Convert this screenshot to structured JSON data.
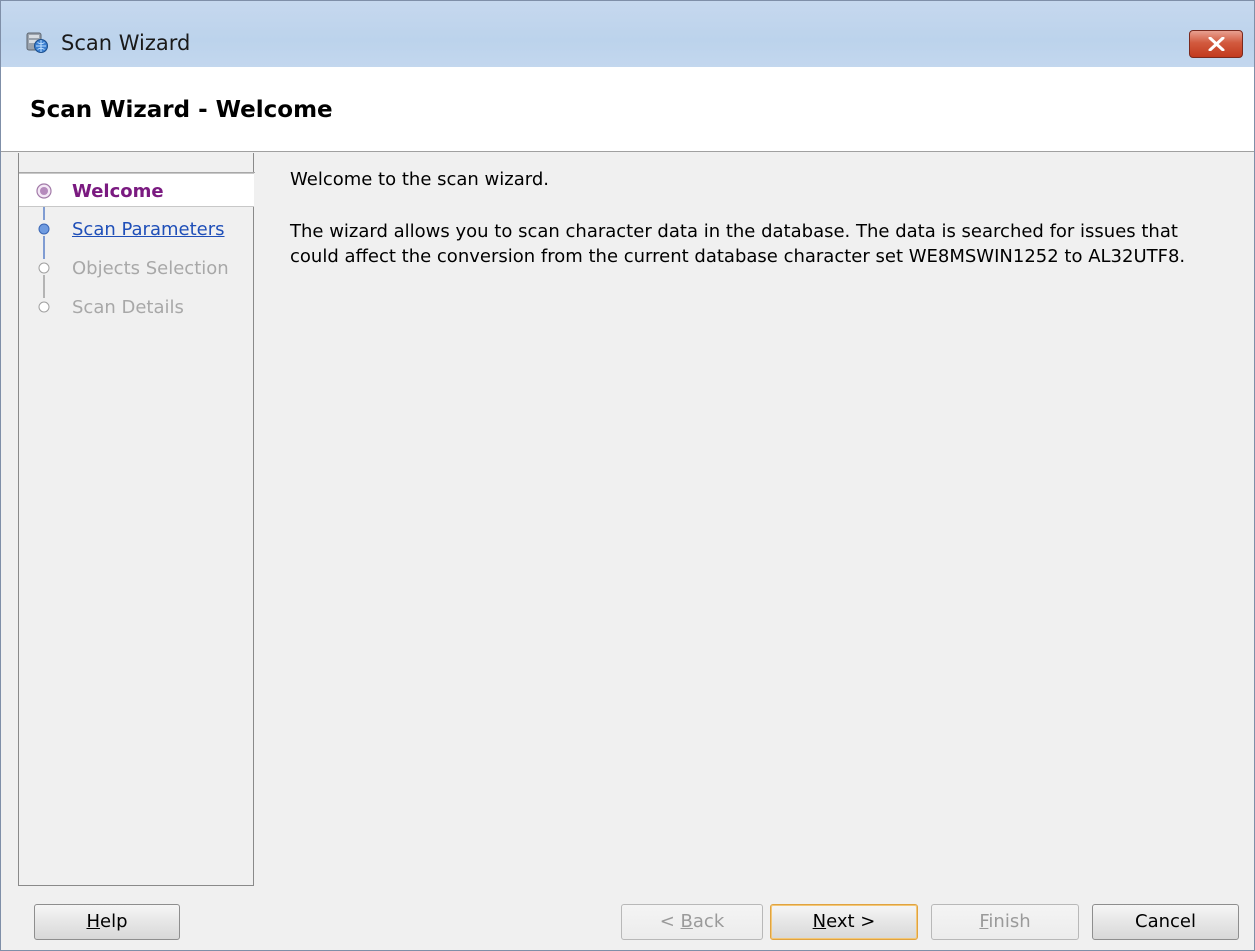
{
  "window": {
    "title": "Scan Wizard",
    "close_label": "close"
  },
  "header": {
    "title": "Scan Wizard - Welcome"
  },
  "steps": [
    {
      "label": "Welcome",
      "state": "current"
    },
    {
      "label": "Scan Parameters",
      "state": "link"
    },
    {
      "label": "Objects Selection",
      "state": "disabled"
    },
    {
      "label": "Scan Details",
      "state": "disabled"
    }
  ],
  "content": {
    "welcome": "Welcome to the scan wizard.",
    "description": "The wizard allows you to scan character data in the database. The data is searched for issues that could affect the conversion from the current database character set WE8MSWIN1252 to AL32UTF8."
  },
  "buttons": {
    "help": {
      "mnemonic": "H",
      "rest": "elp"
    },
    "back": {
      "prefix": "< ",
      "mnemonic": "B",
      "rest": "ack"
    },
    "next": {
      "mnemonic": "N",
      "rest": "ext >"
    },
    "finish": {
      "mnemonic": "F",
      "rest": "inish"
    },
    "cancel": {
      "label": "Cancel"
    }
  },
  "colors": {
    "current_step": "#7a1a80",
    "link_step": "#1f4fb8",
    "disabled_step": "#a8a8a8",
    "default_button_border": "#e0a340",
    "close_button": "#c23a1e"
  },
  "icons": {
    "app": "database-globe-icon",
    "close": "close-x-icon"
  }
}
